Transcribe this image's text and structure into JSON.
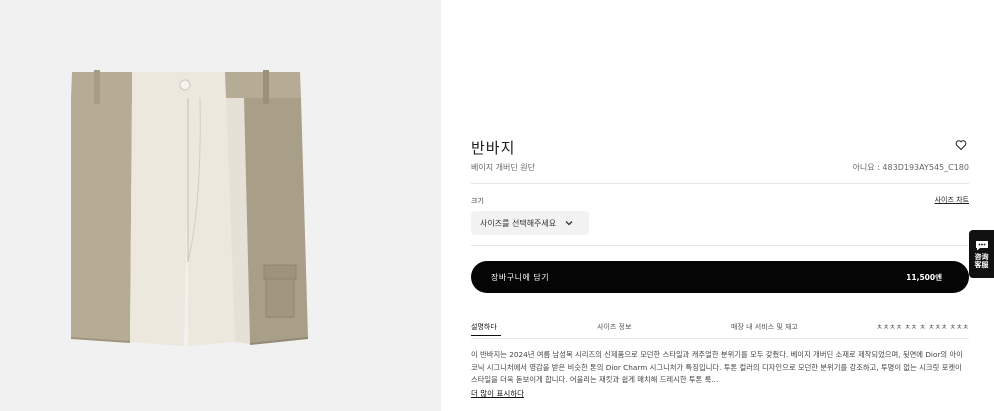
{
  "product": {
    "title": "반바지",
    "subtitle": "베이지 개버딘 원단",
    "reference": "아니요 : 483D193AY545_C180",
    "wishlist_icon": "heart-icon"
  },
  "size": {
    "label": "크기",
    "chart_link": "사이즈 차트",
    "select_placeholder": "사이즈를 선택해주세요"
  },
  "cart": {
    "label": "장바구니에 담기",
    "price": "11,500엔"
  },
  "tabs": [
    {
      "label": "설명하다",
      "active": true
    },
    {
      "label": "사이즈 정보",
      "active": false
    },
    {
      "label": "매장 내 서비스 및 재고",
      "active": false
    },
    {
      "label": "ㅊㅊㅊㅊ ㅊㅊ ㅊ ㅊㅊㅊ ㅊㅊㅊ",
      "active": false
    }
  ],
  "description": "이 반바지는 2024년 여름 남성복 시리즈의 신제품으로 모던한 스타일과 캐주얼한 분위기를 모두 갖췄다. 베이지 개버딘 소재로 제작되었으며, 뒷면에 Dior의 아이코닉 시그니처에서 영감을 받은 비슷한 톤의 Dior Charm 시그니처가 특징입니다. 투톤 컬러의 디자인으로 모던한 분위기를 강조하고, 투명이 없는 시크릿 포켓이 스타일을 더욱 돋보이게 합니다. 어울리는 재킷과 쉽게 매치해 드레시한 투톤 룩...",
  "more_link": "더 많이 표시하다",
  "chat": {
    "label_line1": "咨询",
    "label_line2": "客服",
    "icon": "chat-bubble-icon"
  },
  "colors": {
    "beige": "#b3a892",
    "cream": "#ebe7dd",
    "black": "#050505",
    "bg": "#f1f1f1"
  }
}
